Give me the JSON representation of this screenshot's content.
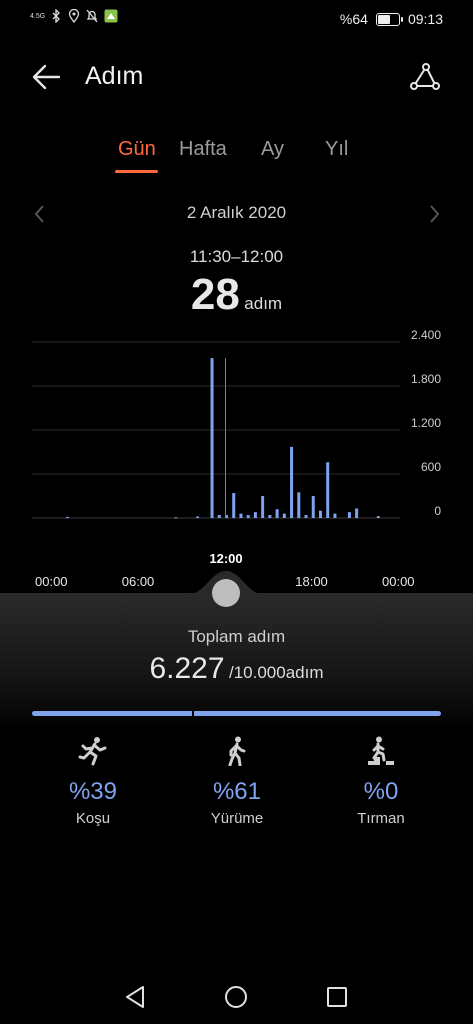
{
  "status_bar": {
    "network": "4.5G",
    "battery_text": "%64",
    "battery_level": 0.64,
    "time": "09:13",
    "icons": [
      "bluetooth-icon",
      "location-icon",
      "bell-off-icon",
      "app-notification-icon"
    ]
  },
  "header": {
    "title": "Adım",
    "back_icon": "arrow-left-icon",
    "share_icon": "share-icon"
  },
  "tabs": [
    {
      "label": "Gün",
      "active": true
    },
    {
      "label": "Hafta",
      "active": false
    },
    {
      "label": "Ay",
      "active": false
    },
    {
      "label": "Yıl",
      "active": false
    }
  ],
  "date_nav": {
    "date": "2 Aralık 2020",
    "prev_icon": "chevron-left-icon",
    "next_icon": "chevron-right-icon"
  },
  "selection": {
    "time_range": "11:30–12:00",
    "steps": "28",
    "unit": "adım",
    "marker_time": "12:00"
  },
  "chart_data": {
    "type": "bar",
    "ylim": [
      0,
      2400
    ],
    "y_ticks": [
      "2.400",
      "1.800",
      "1.200",
      "600",
      "0"
    ],
    "y_tick_values": [
      2400,
      1800,
      1200,
      600,
      0
    ],
    "x_ticks": [
      "00:00",
      "06:00",
      "12:00",
      "18:00",
      "00:00"
    ],
    "x_tick_hours": [
      0,
      6,
      12,
      18,
      24
    ],
    "bar_hours": [
      1.0,
      8.5,
      10.0,
      11.0,
      11.5,
      12.0,
      12.5,
      13.0,
      13.5,
      14.0,
      14.5,
      15.0,
      15.5,
      16.0,
      16.5,
      17.0,
      17.5,
      18.0,
      18.5,
      19.0,
      19.5,
      20.5,
      21.0,
      22.5
    ],
    "values": [
      15,
      10,
      20,
      2180,
      40,
      40,
      340,
      60,
      40,
      80,
      300,
      40,
      120,
      60,
      970,
      350,
      40,
      300,
      100,
      760,
      60,
      80,
      130,
      25
    ],
    "selected_hour": 12.0
  },
  "summary": {
    "label": "Toplam adım",
    "value": "6.227",
    "goal": "/10.000adım",
    "split_fraction": 0.39
  },
  "activities": [
    {
      "icon": "running-icon",
      "percent": "%39",
      "name": "Koşu"
    },
    {
      "icon": "walking-icon",
      "percent": "%61",
      "name": "Yürüme"
    },
    {
      "icon": "climbing-icon",
      "percent": "%0",
      "name": "Tırman"
    }
  ],
  "colors": {
    "accent": "#ff6a3c",
    "bar": "#7fa3ee",
    "background": "#000000"
  }
}
